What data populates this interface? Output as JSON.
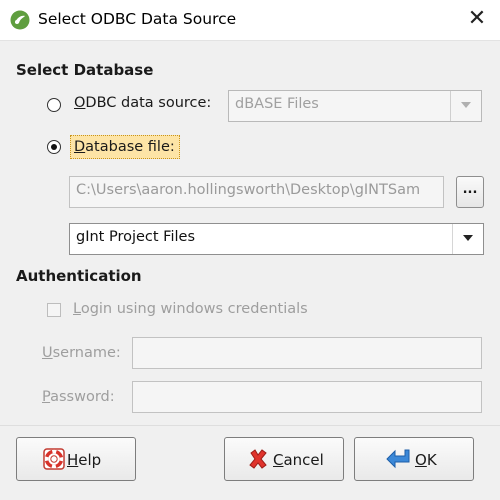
{
  "window": {
    "title": "Select ODBC Data Source",
    "close_symbol": "✕"
  },
  "select_database": {
    "heading": "Select Database",
    "odbc_option": {
      "label_mnemonic": "O",
      "label_rest": "DBC data source:",
      "selected": false,
      "combo_value": "dBASE Files"
    },
    "file_option": {
      "label_mnemonic": "D",
      "label_rest": "atabase file:",
      "selected": true
    },
    "file_path": "C:\\Users\\aaron.hollingsworth\\Desktop\\gINTSam",
    "browse_label": "...",
    "file_type_value": "gInt Project Files"
  },
  "authentication": {
    "heading": "Authentication",
    "windows_credentials_label_mnemonic": "L",
    "windows_credentials_label_rest": "ogin using windows credentials",
    "windows_credentials_checked": false,
    "username_label_mnemonic": "U",
    "username_label_rest": "sername:",
    "username_value": "",
    "password_label_mnemonic": "P",
    "password_label_rest": "assword:",
    "password_value": ""
  },
  "buttons": {
    "help_mnemonic": "H",
    "help_rest": "elp",
    "cancel_mnemonic": "C",
    "cancel_rest": "ancel",
    "ok_mnemonic": "O",
    "ok_rest": "K"
  },
  "colors": {
    "accent_focus": "#fde4a6",
    "app_icon": "#6aa84f",
    "cancel_icon": "#d9302c",
    "ok_icon": "#2f7fd4"
  },
  "icons": {
    "app": "app-logo-icon",
    "help": "lifebuoy-icon",
    "cancel": "red-x-icon",
    "ok": "enter-arrow-icon"
  }
}
